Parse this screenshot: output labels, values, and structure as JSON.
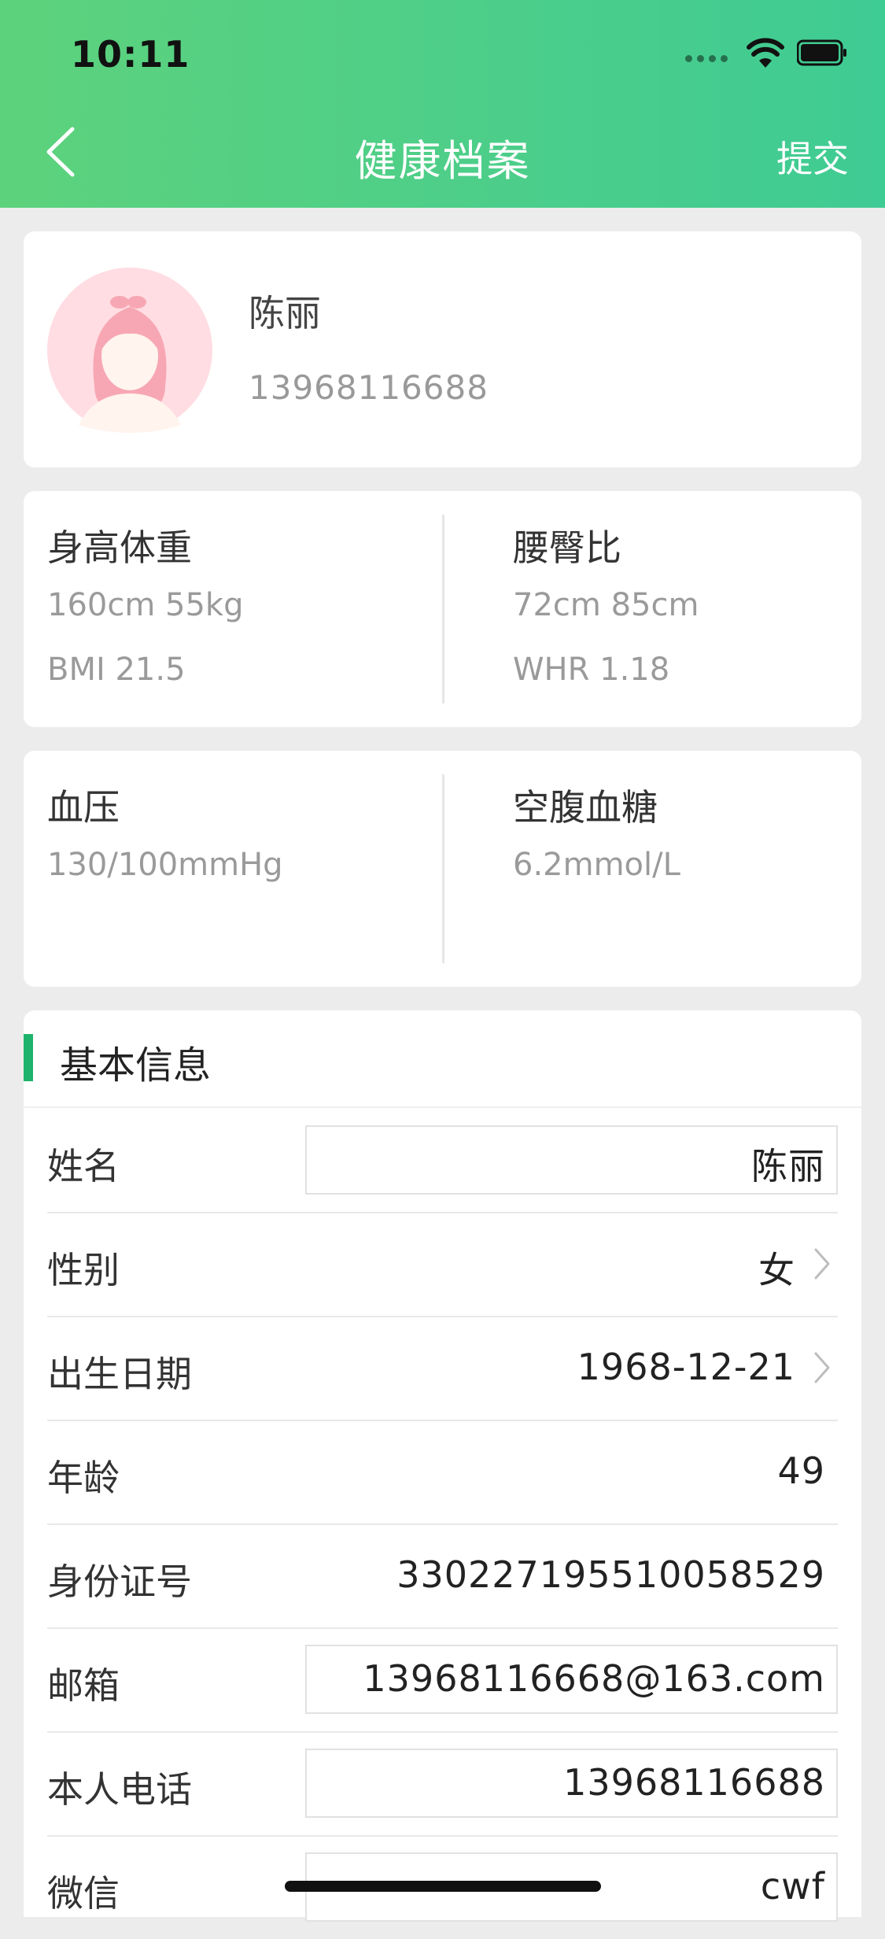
{
  "status_bar": {
    "time": "10:11"
  },
  "nav": {
    "title": "健康档案",
    "submit_label": "提交"
  },
  "profile": {
    "name": "陈丽",
    "phone": "13968116688"
  },
  "metrics": [
    {
      "left": {
        "title": "身高体重",
        "line1": "160cm 55kg",
        "line2": "BMI 21.5"
      },
      "right": {
        "title": "腰臀比",
        "line1": "72cm 85cm",
        "line2": "WHR 1.18"
      }
    },
    {
      "left": {
        "title": "血压",
        "line1": "130/100mmHg",
        "line2": ""
      },
      "right": {
        "title": "空腹血糖",
        "line1": "6.2mmol/L",
        "line2": ""
      }
    }
  ],
  "basic_info": {
    "section_title": "基本信息",
    "rows": [
      {
        "label": "姓名",
        "value": "陈丽"
      },
      {
        "label": "性别",
        "value": "女"
      },
      {
        "label": "出生日期",
        "value": "1968-12-21"
      },
      {
        "label": "年龄",
        "value": "49"
      },
      {
        "label": "身份证号",
        "value": "330227195510058529"
      },
      {
        "label": "邮箱",
        "value": "13968116668@163.com"
      },
      {
        "label": "本人电话",
        "value": "13968116688"
      },
      {
        "label": "微信",
        "value": "cwf"
      }
    ]
  },
  "colors": {
    "header_gradient_start": "#5DD27C",
    "header_gradient_end": "#3FCB94",
    "accent_bar": "#1DB36C",
    "background": "#ECECEC"
  },
  "icons": {
    "back": "chevron-left-icon",
    "chevron": "chevron-right-icon",
    "avatar": "female-avatar-icon",
    "wifi": "wifi-icon",
    "battery": "battery-icon",
    "signal": "signal-icon"
  }
}
